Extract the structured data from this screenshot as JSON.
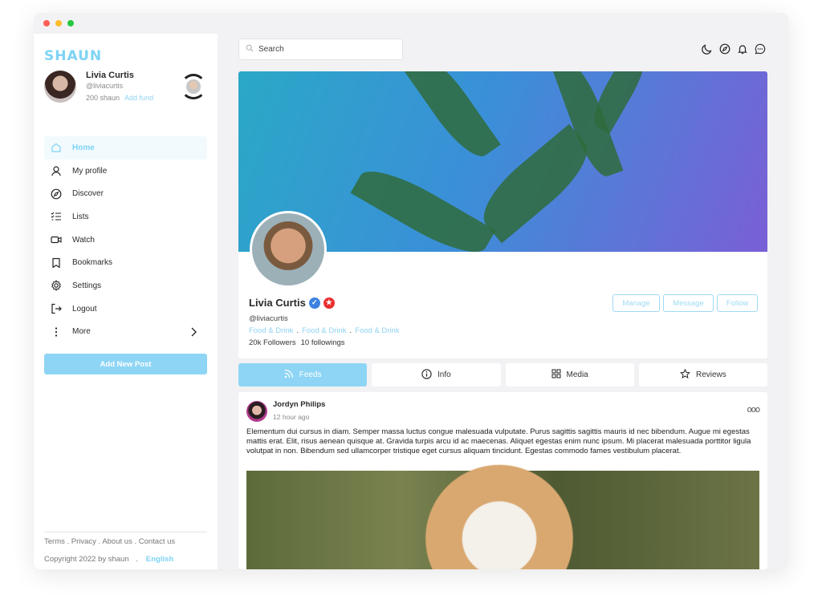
{
  "app": {
    "logo": "SHAUN"
  },
  "user": {
    "name": "Livia Curtis",
    "handle": "@liviacurtis",
    "balance": "200 shaun",
    "add_fund": "Add fund"
  },
  "sidebar": {
    "items": [
      {
        "label": "Home",
        "icon": "home-icon"
      },
      {
        "label": "My profile",
        "icon": "user-icon"
      },
      {
        "label": "Discover",
        "icon": "compass-icon"
      },
      {
        "label": "Lists",
        "icon": "list-icon"
      },
      {
        "label": "Watch",
        "icon": "video-icon"
      },
      {
        "label": "Bookmarks",
        "icon": "bookmark-icon"
      },
      {
        "label": "Settings",
        "icon": "gear-icon"
      },
      {
        "label": "Logout",
        "icon": "logout-icon"
      },
      {
        "label": "More",
        "icon": "more-vertical-icon"
      }
    ],
    "add_post": "Add New Post",
    "footer_links": "Terms . Privacy . About us . Contact us",
    "copyright": "Copyright 2022 by shaun",
    "copyright_sep": ".",
    "language": "English"
  },
  "search": {
    "placeholder": "Search"
  },
  "profile": {
    "name": "Livia Curtis",
    "handle": "@liviacurtis",
    "tags": [
      "Food & Drink",
      "Food & Drink",
      "Food & Drink"
    ],
    "tag_sep": ".",
    "followers": "20k Followers",
    "followings": "10 followings",
    "buttons": {
      "manage": "Manage",
      "message": "Message",
      "follow": "Follow"
    }
  },
  "tabs": [
    {
      "label": "Feeds",
      "icon": "rss-icon"
    },
    {
      "label": "Info",
      "icon": "info-icon"
    },
    {
      "label": "Media",
      "icon": "grid-icon"
    },
    {
      "label": "Reviews",
      "icon": "star-icon"
    }
  ],
  "post": {
    "author": "Jordyn Philips",
    "time": "12 hour ago",
    "more": "ooo",
    "body": "Elementum dui cursus in diam. Semper massa luctus congue malesuada vulputate. Purus sagittis sagittis mauris id nec bibendum. Augue mi egestas mattis erat. Elit, risus aenean quisque at. Gravida turpis arcu id ac maecenas. Aliquet egestas enim nunc ipsum. Mi placerat malesuada porttitor ligula volutpat in non. Bibendum sed ullamcorper tristique eget cursus aliquam tincidunt. Egestas commodo fames vestibulum placerat."
  },
  "colors": {
    "accent": "#8ed5f5",
    "accent_text": "#7dd3f5",
    "verified": "#3d82e0",
    "badge_red": "#e82f2f"
  }
}
